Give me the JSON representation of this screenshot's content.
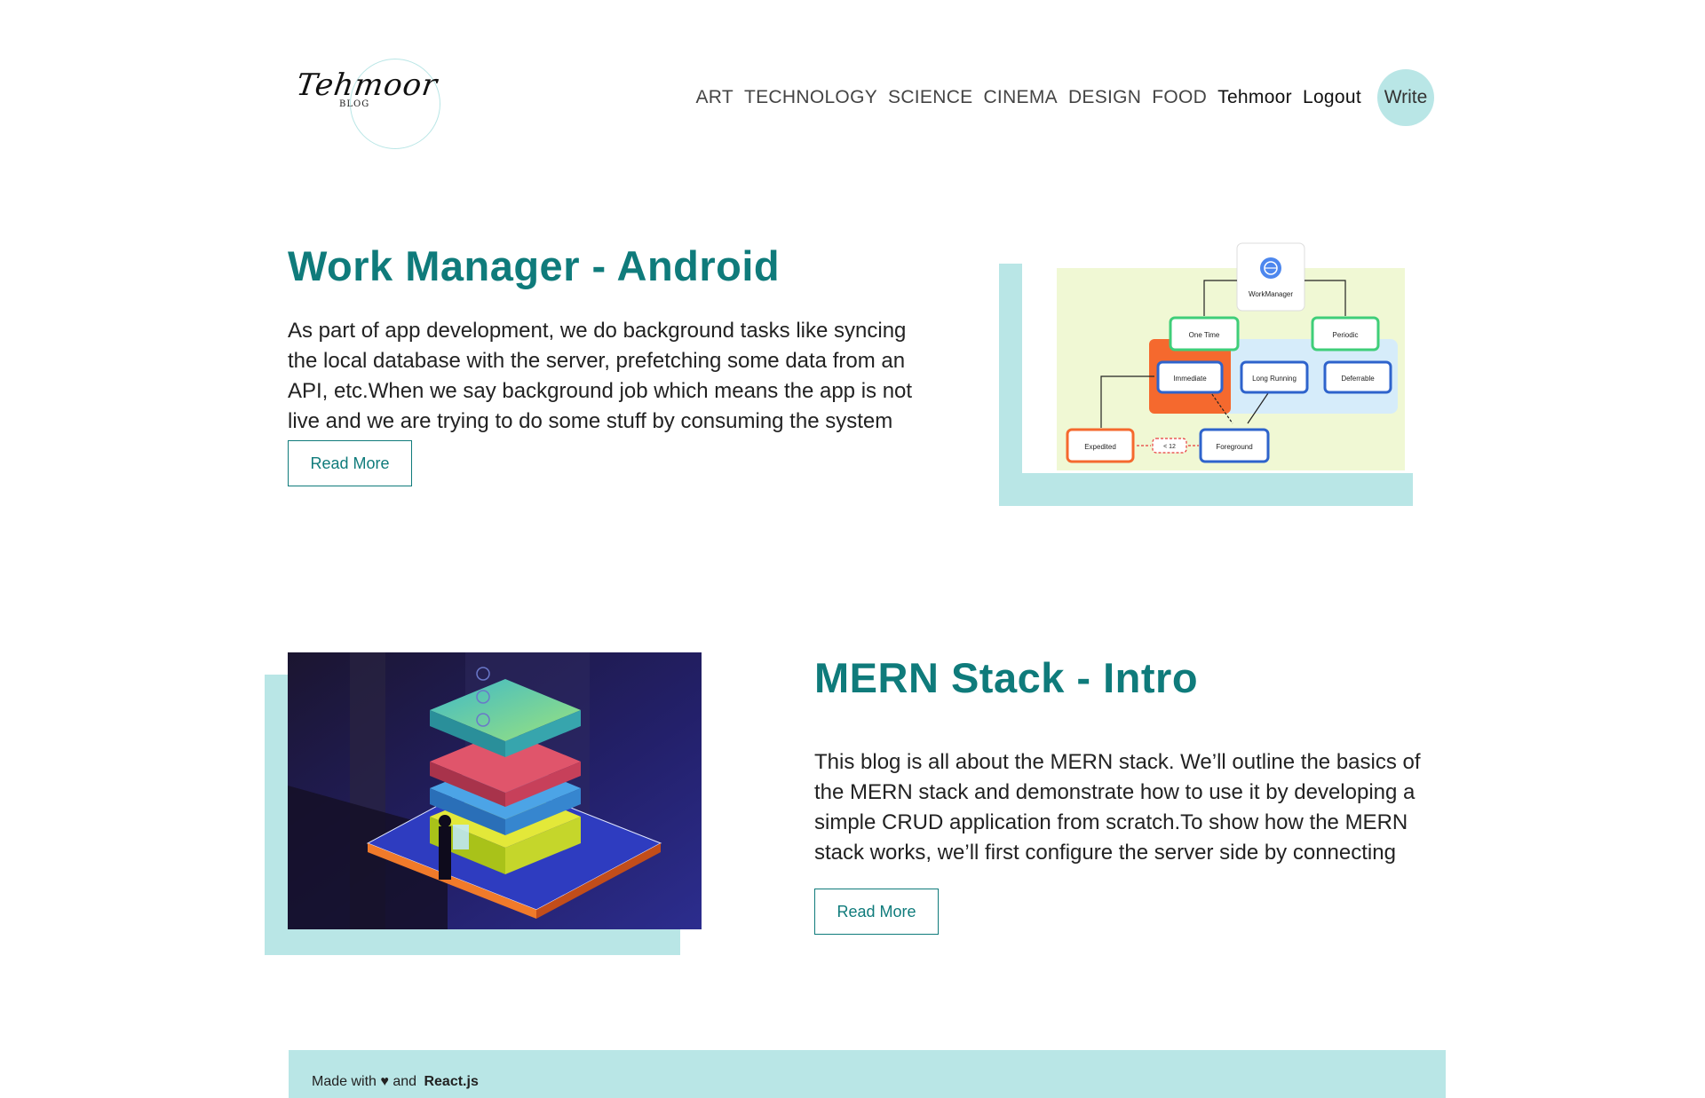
{
  "logo": {
    "script": "Tehmoor",
    "sub": "BLOG"
  },
  "nav": {
    "categories": [
      "ART",
      "TECHNOLOGY",
      "SCIENCE",
      "CINEMA",
      "DESIGN",
      "FOOD"
    ],
    "user": "Tehmoor",
    "logout": "Logout",
    "write": "Write"
  },
  "posts": [
    {
      "title": "Work Manager - Android",
      "excerpt": "As part of app development, we do background tasks like syncing the local database with the server, prefetching some data from an API, etc.When we say background job which means the app is not live and we are trying to do some stuff by consuming the system",
      "read_more": "Read More",
      "diagram": {
        "root": "WorkManager",
        "one_time": "One Time",
        "periodic": "Periodic",
        "immediate": "Immediate",
        "long_running": "Long Running",
        "deferrable": "Deferrable",
        "expedited": "Expedited",
        "limit": "< 12",
        "foreground": "Foreground"
      }
    },
    {
      "title": "MERN Stack - Intro",
      "excerpt": "This blog is all about the MERN stack. We’ll outline the basics of the MERN stack and demonstrate how to use it by developing a simple CRUD application from scratch.To show how the MERN stack works, we’ll first configure the server side by connecting",
      "read_more": "Read More"
    }
  ],
  "footer": {
    "prefix": "Made with ",
    "heart": "♥",
    "middle": " and ",
    "brand": "React.js"
  },
  "colors": {
    "accent": "#0f7b7b",
    "backdrop": "#b9e6e6"
  }
}
